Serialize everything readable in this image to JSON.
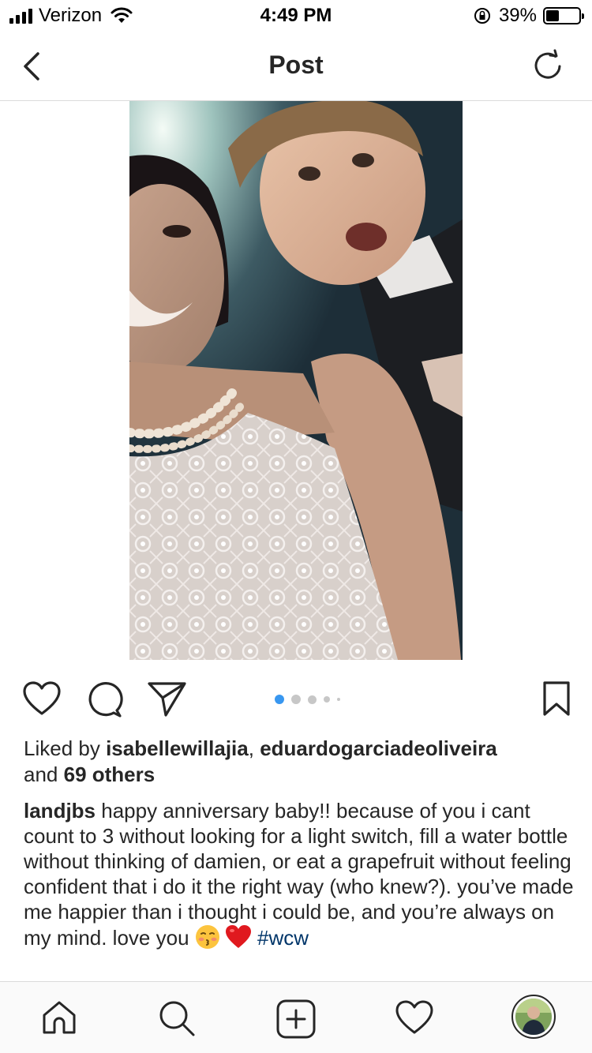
{
  "status_bar": {
    "carrier": "Verizon",
    "time": "4:49 PM",
    "battery_percent": "39%",
    "battery_level": 0.39
  },
  "nav": {
    "title": "Post",
    "back_icon": "chevron-left-icon",
    "refresh_icon": "refresh-icon"
  },
  "post": {
    "carousel": {
      "total": 5,
      "active_index": 0
    },
    "likes": {
      "prefix": "Liked by ",
      "user1": "isabellewillajia",
      "separator": ", ",
      "user2": "eduardogarciadeoliveira",
      "and": "and ",
      "others": "69 others"
    },
    "caption": {
      "username": "landjbs",
      "text": "happy anniversary baby!! because of you i cant count to 3 without looking for a light switch, fill a water bottle without thinking of damien, or eat a grapefruit without feeling confident that i do it the right way (who knew?). you’ve made me happier than i thought i could be, and you’re always on my mind. love you",
      "hashtag": "#wcw",
      "emojis": [
        "kissing-face-emoji",
        "red-heart-emoji"
      ]
    }
  },
  "tabbar": {
    "items": [
      "home-icon",
      "search-icon",
      "new-post-icon",
      "activity-icon",
      "profile-avatar"
    ]
  },
  "colors": {
    "text": "#262626",
    "hashtag": "#003569",
    "active_dot": "#3897f0",
    "inactive_dot": "#c7c7c7",
    "divider": "#dbdbdb"
  }
}
